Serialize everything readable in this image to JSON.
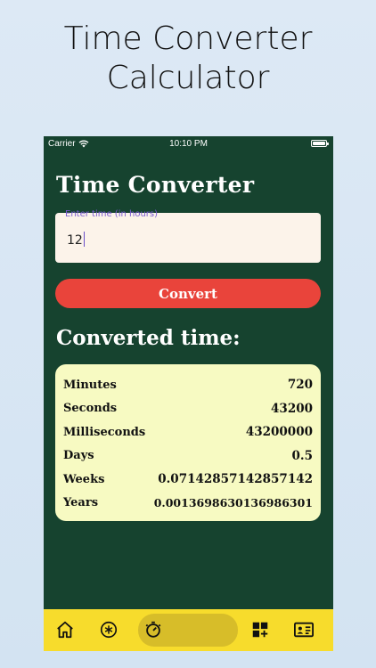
{
  "promo": {
    "line1": "Time Converter",
    "line2": "Calculator"
  },
  "status_bar": {
    "carrier": "Carrier",
    "time": "10:10 PM"
  },
  "app": {
    "title": "Time Converter",
    "input": {
      "label": "Enter time (in hours)",
      "value": "12"
    },
    "convert_label": "Convert",
    "results_title": "Converted time:",
    "results": [
      {
        "label": "Minutes",
        "value": "720"
      },
      {
        "label": "Seconds",
        "value": "43200"
      },
      {
        "label": "Milliseconds",
        "value": "43200000"
      },
      {
        "label": "Days",
        "value": "0.5"
      },
      {
        "label": "Weeks",
        "value": "0.07142857142857142"
      },
      {
        "label": "Years",
        "value": "0.0013698630136986301"
      }
    ]
  },
  "tabs": [
    {
      "icon": "home-icon"
    },
    {
      "icon": "asterisk-circle-icon"
    },
    {
      "icon": "clock-dial-icon",
      "active": true
    },
    {
      "icon": "grid-plus-icon"
    },
    {
      "icon": "id-card-icon"
    }
  ],
  "colors": {
    "app_background": "#16432f",
    "accent_red": "#e9443b",
    "results_card": "#f7fac2",
    "tab_bar": "#f7dc2c",
    "active_tab": "#d7bd29"
  }
}
